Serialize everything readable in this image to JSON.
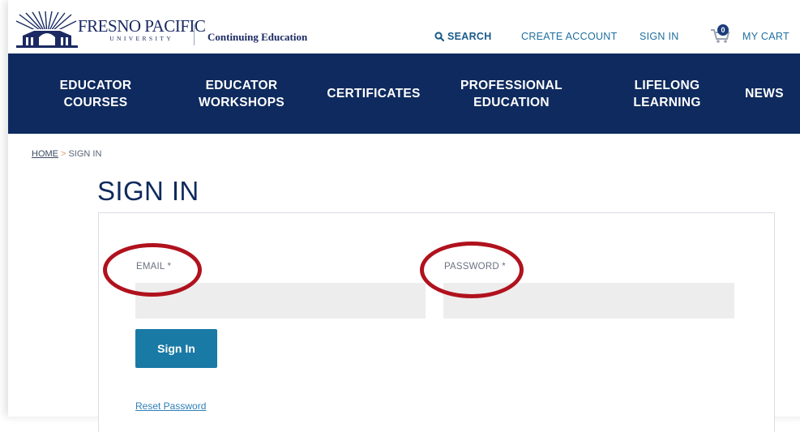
{
  "header": {
    "logo_name": "FRESNO PACIFIC",
    "logo_sub": "UNIVERSITY",
    "site_title": "Continuing Education",
    "utility_links": {
      "search": "SEARCH",
      "create_account": "CREATE ACCOUNT",
      "sign_in": "SIGN IN",
      "cart_count": "0",
      "my_cart": "MY CART"
    }
  },
  "nav": {
    "items": [
      {
        "line1": "EDUCATOR",
        "line2": "COURSES"
      },
      {
        "line1": "EDUCATOR",
        "line2": "WORKSHOPS"
      },
      {
        "line1": "CERTIFICATES",
        "line2": ""
      },
      {
        "line1": "PROFESSIONAL",
        "line2": "EDUCATION"
      },
      {
        "line1": "LIFELONG",
        "line2": "LEARNING"
      },
      {
        "line1": "NEWS",
        "line2": ""
      }
    ]
  },
  "breadcrumb": {
    "home": "HOME",
    "separator": ">",
    "current": "SIGN IN"
  },
  "main": {
    "title": "SIGN IN",
    "email_label": "EMAIL *",
    "email_value": "",
    "password_label": "PASSWORD *",
    "password_value": "",
    "submit_label": "Sign In",
    "reset_link": "Reset Password"
  },
  "colors": {
    "nav_bg": "#0e2a5e",
    "brand_navy": "#1b2a63",
    "button_bg": "#1a7aa6",
    "annotation_red": "#b0121d"
  }
}
